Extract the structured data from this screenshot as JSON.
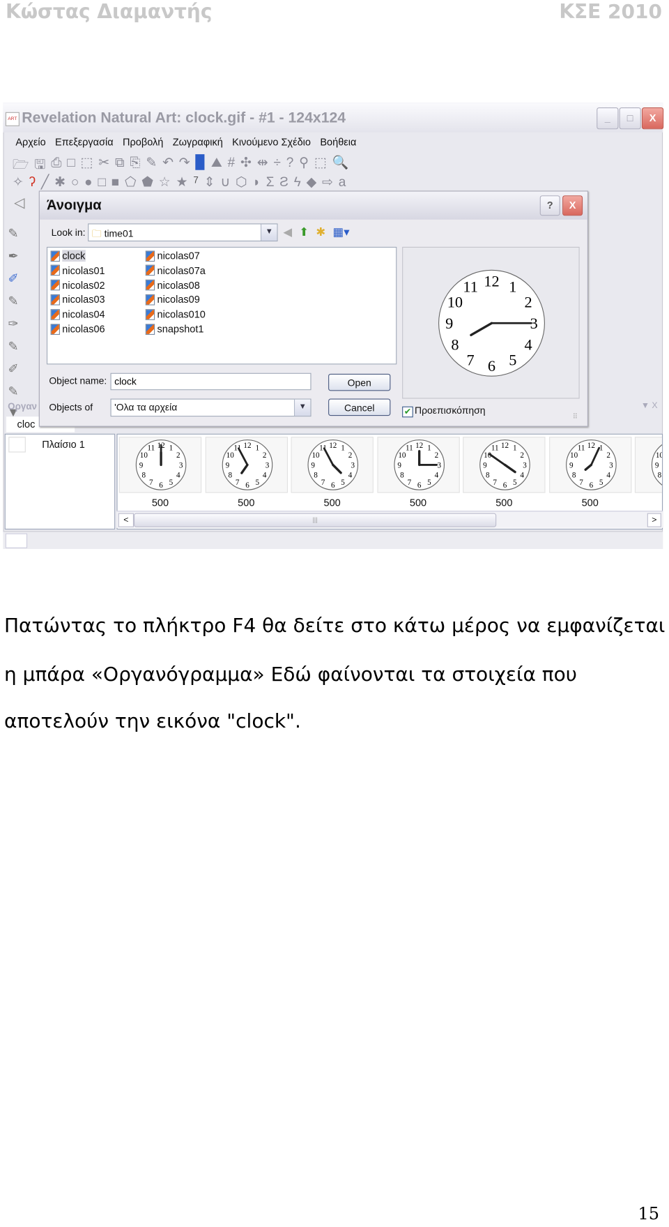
{
  "header": {
    "author": "Κώστας Διαμαντής",
    "course": "ΚΣΕ 2010"
  },
  "app": {
    "title": "Revelation Natural Art: clock.gif - #1 - 124x124",
    "logo_text": "ART",
    "menu": [
      "Αρχείο",
      "Επεξεργασία",
      "Προβολή",
      "Ζωγραφική",
      "Κινούμενο Σχέδιο",
      "Βοήθεια"
    ],
    "toolbar_number": "7",
    "panel_title": "Οργαν",
    "panel_tab": "cloc",
    "panel_controls": "▼ X",
    "frame_row_label": "Πλαίσιο 1",
    "frames": [
      "500",
      "500",
      "500",
      "500",
      "500",
      "500"
    ],
    "scroll_grip": "|||"
  },
  "dialog": {
    "title": "Άνοιγμα",
    "look_in_label": "Look in:",
    "look_in_value": "time01",
    "files_col1": [
      "clock",
      "nicolas01",
      "nicolas02",
      "nicolas03",
      "nicolas04",
      "nicolas06"
    ],
    "files_col2": [
      "nicolas07",
      "nicolas07a",
      "nicolas08",
      "nicolas09",
      "nicolas010",
      "snapshot1"
    ],
    "selected_file": "clock",
    "object_name_label": "Object name:",
    "object_name_value": "clock",
    "objects_of_label": "Objects of",
    "objects_of_value": "'Ολα τα αρχεία",
    "open_label": "Open",
    "cancel_label": "Cancel",
    "preview_label": "Προεπισκόπηση",
    "preview_checked": true
  },
  "caption": [
    "Πατώντας το πλήκτρο F4 θα δείτε στο κάτω μέρος να εμφανίζεται",
    "η μπάρα «Οργανόγραμμα» Εδώ φαίνονται τα στοιχεία που",
    "αποτελούν την εικόνα \"clock\"."
  ],
  "page_number": "15",
  "colors": {
    "header_gray": "#c8c8c8",
    "close_red": "#d9685e",
    "dialog_bg": "#ecebf0"
  }
}
